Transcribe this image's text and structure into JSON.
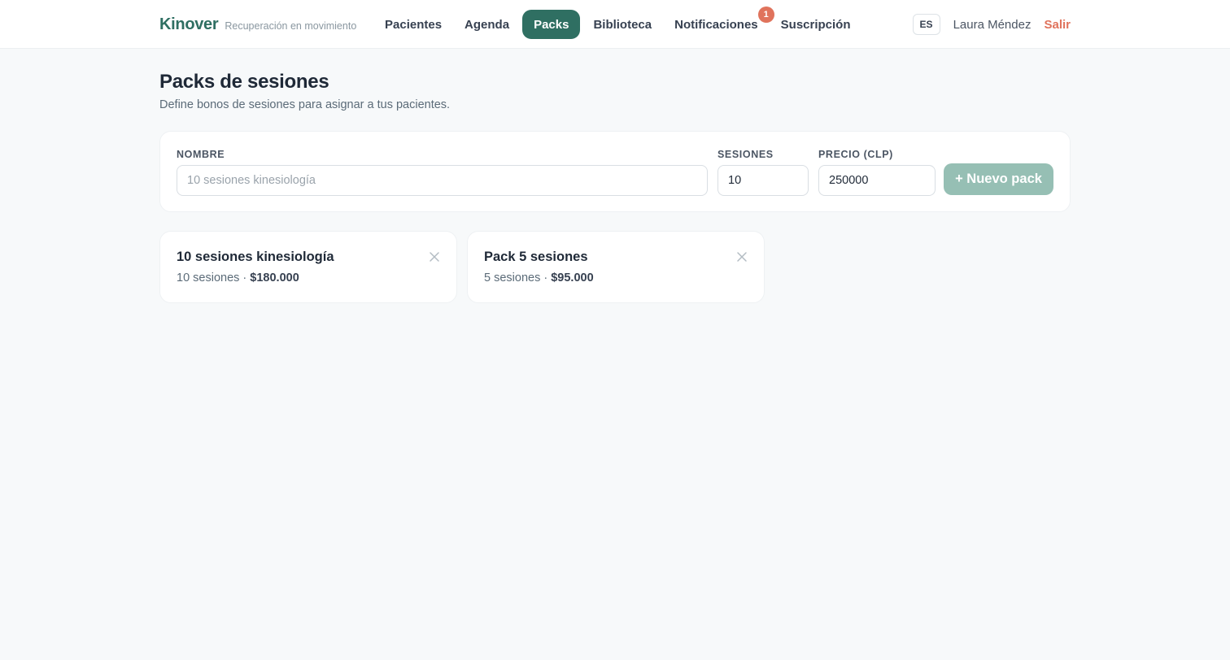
{
  "header": {
    "brand": "Kinover",
    "tagline": "Recuperación en movimiento",
    "nav": [
      {
        "label": "Pacientes"
      },
      {
        "label": "Agenda"
      },
      {
        "label": "Packs",
        "active": true
      },
      {
        "label": "Biblioteca"
      },
      {
        "label": "Notificaciones",
        "badge": "1"
      },
      {
        "label": "Suscripción"
      }
    ],
    "language": "ES",
    "user_name": "Laura Méndez",
    "logout_label": "Salir"
  },
  "page": {
    "title": "Packs de sesiones",
    "subtitle": "Define bonos de sesiones para asignar a tus pacientes."
  },
  "form": {
    "name_label": "NOMBRE",
    "name_placeholder": "10 sesiones kinesiología",
    "name_value": "",
    "sessions_label": "SESIONES",
    "sessions_value": "10",
    "price_label": "PRECIO (CLP)",
    "price_value": "250000",
    "submit_label": "+ Nuevo pack"
  },
  "packs": [
    {
      "name": "10 sesiones kinesiología",
      "sessions": "10 sesiones",
      "separator": " · ",
      "price": "$180.000"
    },
    {
      "name": "Pack 5 sesiones",
      "sessions": "5 sesiones",
      "separator": " · ",
      "price": "$95.000"
    }
  ],
  "colors": {
    "brand": "#2f6f62",
    "accent_danger": "#e0735c",
    "button_disabled": "#96bfb4",
    "background": "#f7f9fa"
  },
  "icons": {
    "pack_delete": "close-icon"
  }
}
